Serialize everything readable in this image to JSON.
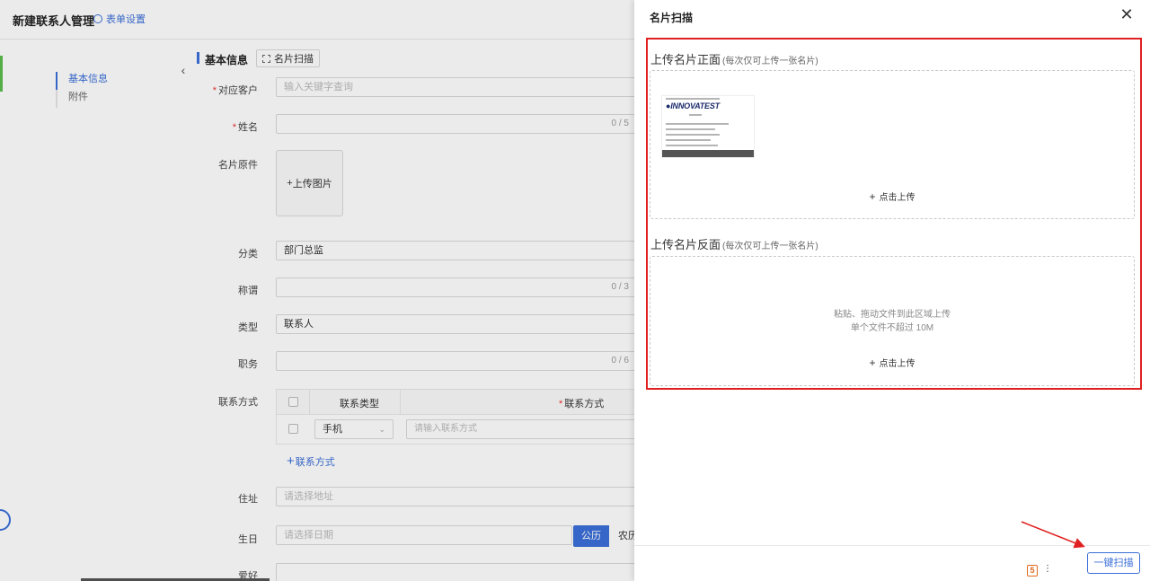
{
  "page": {
    "title": "新建联系人管理",
    "form_settings": "表单设置"
  },
  "anchors": [
    "基本信息",
    "附件"
  ],
  "section": {
    "title": "基本信息",
    "scan_button": "名片扫描"
  },
  "fields": {
    "customer": {
      "label": "对应客户",
      "placeholder": "输入关键字查询"
    },
    "name": {
      "label": "姓名",
      "counter": "0 / 5"
    },
    "card_original": {
      "label": "名片原件",
      "upload": "上传图片"
    },
    "category": {
      "label": "分类",
      "value": "部门总监"
    },
    "title_field": {
      "label": "称谓",
      "counter": "0 / 3"
    },
    "type": {
      "label": "类型",
      "value": "联系人"
    },
    "position": {
      "label": "职务",
      "counter": "0 / 6"
    },
    "contact": {
      "label": "联系方式",
      "col_type": "联系类型",
      "col_method": "联系方式",
      "row_type": "手机",
      "row_placeholder": "请输入联系方式",
      "add_label": "联系方式"
    },
    "address": {
      "label": "住址",
      "placeholder": "请选择地址"
    },
    "birthday": {
      "label": "生日",
      "placeholder": "请选择日期",
      "solar": "公历",
      "lunar": "农历"
    },
    "hobby": {
      "label": "爱好"
    }
  },
  "drawer": {
    "title": "名片扫描",
    "front": {
      "title": "上传名片正面",
      "hint": "(每次仅可上传一张名片)",
      "upload": "点击上传"
    },
    "back": {
      "title": "上传名片反面",
      "hint": "(每次仅可上传一张名片)",
      "drop_hint_1": "粘贴、拖动文件到此区域上传",
      "drop_hint_2": "单个文件不超过 10M",
      "upload": "点击上传"
    },
    "card_brand": "INNOVATEST",
    "scan_button": "一键扫描"
  },
  "colors": {
    "accent": "#3b6fd8",
    "highlight": "#e02020",
    "required": "#e33333"
  }
}
